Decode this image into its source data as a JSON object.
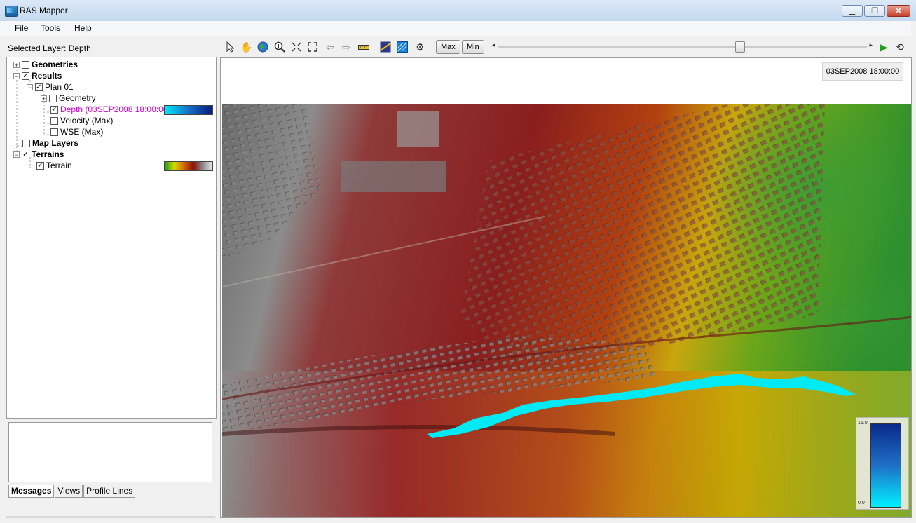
{
  "window": {
    "title": "RAS Mapper"
  },
  "menu": {
    "items": [
      "File",
      "Tools",
      "Help"
    ]
  },
  "toolbar": {
    "selected_layer": "Selected Layer: Depth",
    "max_label": "Max",
    "min_label": "Min",
    "slider_value_fraction": 0.66
  },
  "tree": {
    "geometries": "Geometries",
    "results": "Results",
    "plan": "Plan 01",
    "geometry": "Geometry",
    "depth": "Depth (03SEP2008 18:00:00)",
    "velocity": "Velocity (Max)",
    "wse": "WSE (Max)",
    "map_layers": "Map Layers",
    "terrains": "Terrains",
    "terrain": "Terrain"
  },
  "tabs": [
    "Messages",
    "Views",
    "Profile Lines"
  ],
  "map": {
    "timestamp": "03SEP2008 18:00:00",
    "legend_max": "15.0",
    "legend_min": "0.0"
  },
  "colors": {
    "depth_label": "#d200d2",
    "flood_cyan": "#00eaf5"
  }
}
